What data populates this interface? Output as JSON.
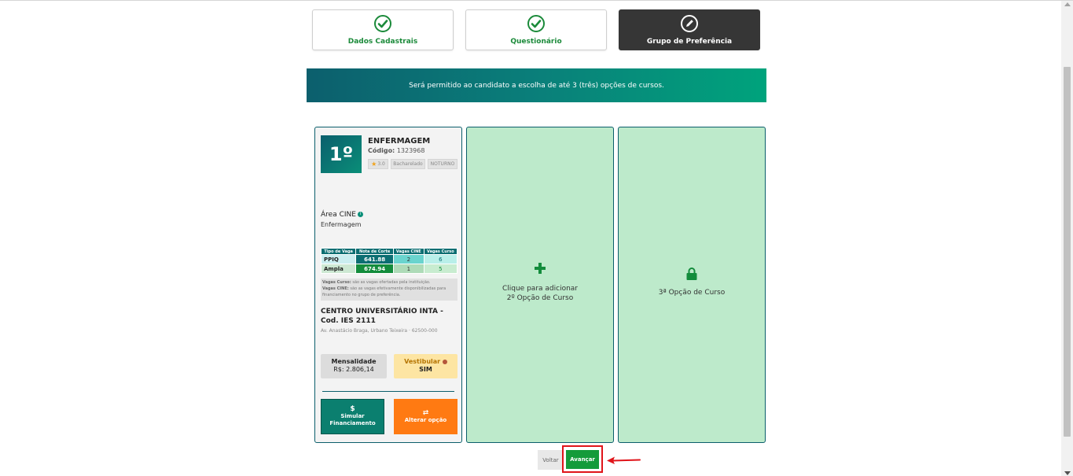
{
  "steps": [
    {
      "label": "Dados Cadastrais",
      "icon": "check-circle-icon",
      "state": "done"
    },
    {
      "label": "Questionário",
      "icon": "check-circle-icon",
      "state": "done"
    },
    {
      "label": "Grupo de Preferência",
      "icon": "pencil-circle-icon",
      "state": "active"
    }
  ],
  "banner": {
    "text": "Será permitido ao candidato a escolha de até 3 (três) opções de cursos."
  },
  "course": {
    "rank": "1º",
    "name": "ENFERMAGEM",
    "code_label": "Código:",
    "code_value": "1323968",
    "rating": "3.0",
    "degree": "Bacharelado",
    "shift": "NOTURNO",
    "area_label": "Área CINE",
    "area_value": "Enfermagem",
    "table": {
      "headers": [
        "Tipo de Vaga",
        "Nota de Corte",
        "Vagas CINE",
        "Vagas Curso"
      ],
      "rows": [
        {
          "tipo": "PPIQ",
          "nota": "641.88",
          "cine": "2",
          "curso": "6"
        },
        {
          "tipo": "Ampla",
          "nota": "674.94",
          "cine": "1",
          "curso": "5"
        }
      ]
    },
    "legend": {
      "curso_label": "Vagas Curso:",
      "curso_text": "são as vagas ofertadas pela instituição.",
      "cine_label": "Vagas CINE:",
      "cine_text": "são as vagas efetivamente disponibilizadas para financiamento no grupo de preferência."
    },
    "institution": "CENTRO UNIVERSITÁRIO INTA - Cod. IES 2111",
    "address": "Av. Anastácio Braga, Urbano Teixeira · 62500-000",
    "mensalidade_label": "Mensalidade",
    "mensalidade_value": "R$: 2.806,14",
    "vestibular_label": "Vestibular",
    "vestibular_value": "SIM",
    "simular_label_1": "Simular",
    "simular_label_2": "Financiamento",
    "simular_glyph": "$",
    "alterar_label": "Alterar opção",
    "alterar_glyph": "⇄"
  },
  "slot2": {
    "line1": "Clique para adicionar",
    "line2": "2º Opção de Curso"
  },
  "slot3": {
    "text": "3ª Opção de Curso"
  },
  "actions": {
    "voltar": "Voltar",
    "avancar": "Avançar"
  },
  "colors": {
    "accent_green": "#149b3a",
    "teal": "#0b6e72",
    "slot_bg": "#bdeacb",
    "orange": "#ff7a12",
    "highlight_red": "#e0141a"
  }
}
